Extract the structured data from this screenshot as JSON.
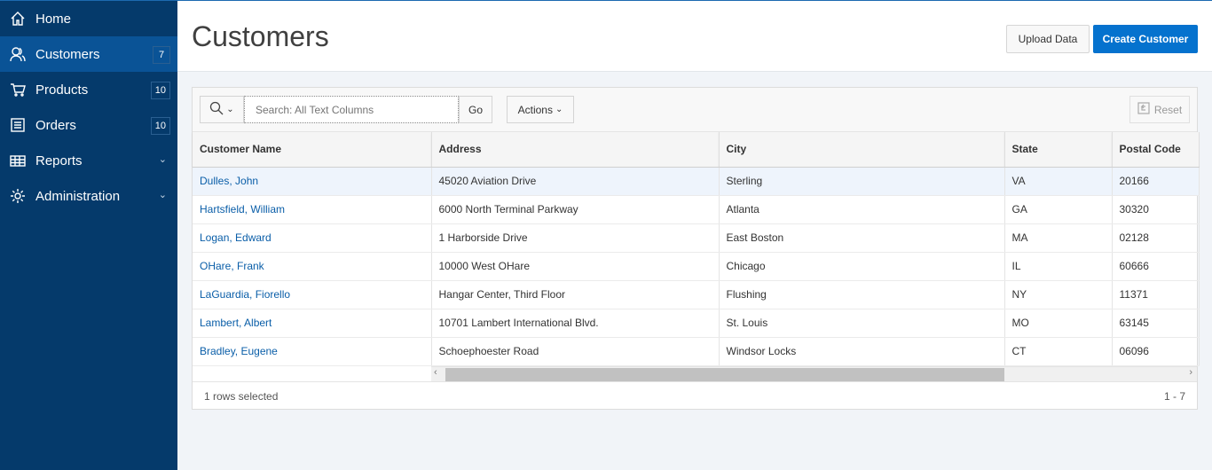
{
  "sidebar": {
    "items": [
      {
        "label": "Home",
        "icon": "home-icon"
      },
      {
        "label": "Customers",
        "icon": "users-icon",
        "badge": "7",
        "active": true
      },
      {
        "label": "Products",
        "icon": "cart-icon",
        "badge": "10"
      },
      {
        "label": "Orders",
        "icon": "list-icon",
        "badge": "10"
      },
      {
        "label": "Reports",
        "icon": "table-icon"
      },
      {
        "label": "Administration",
        "icon": "gear-icon"
      }
    ]
  },
  "header": {
    "title": "Customers",
    "upload_label": "Upload Data",
    "create_label": "Create Customer"
  },
  "toolbar": {
    "search_placeholder": "Search: All Text Columns",
    "go_label": "Go",
    "actions_label": "Actions",
    "reset_label": "Reset"
  },
  "table": {
    "columns": [
      "Customer Name",
      "Address",
      "City",
      "State",
      "Postal Code"
    ],
    "rows": [
      [
        "Dulles, John",
        "45020 Aviation Drive",
        "Sterling",
        "VA",
        "20166"
      ],
      [
        "Hartsfield, William",
        "6000 North Terminal Parkway",
        "Atlanta",
        "GA",
        "30320"
      ],
      [
        "Logan, Edward",
        "1 Harborside Drive",
        "East Boston",
        "MA",
        "02128"
      ],
      [
        "OHare, Frank",
        "10000 West OHare",
        "Chicago",
        "IL",
        "60666"
      ],
      [
        "LaGuardia, Fiorello",
        "Hangar Center, Third Floor",
        "Flushing",
        "NY",
        "11371"
      ],
      [
        "Lambert, Albert",
        "10701 Lambert International Blvd.",
        "St. Louis",
        "MO",
        "63145"
      ],
      [
        "Bradley, Eugene",
        "Schoephoester Road",
        "Windsor Locks",
        "CT",
        "06096"
      ]
    ]
  },
  "footer": {
    "selected": "1 rows selected",
    "range": "1 - 7"
  },
  "colors": {
    "sidebar": "#053a6b",
    "active": "#0a5396",
    "primary": "#0572ce",
    "link": "#0a5ea8"
  }
}
